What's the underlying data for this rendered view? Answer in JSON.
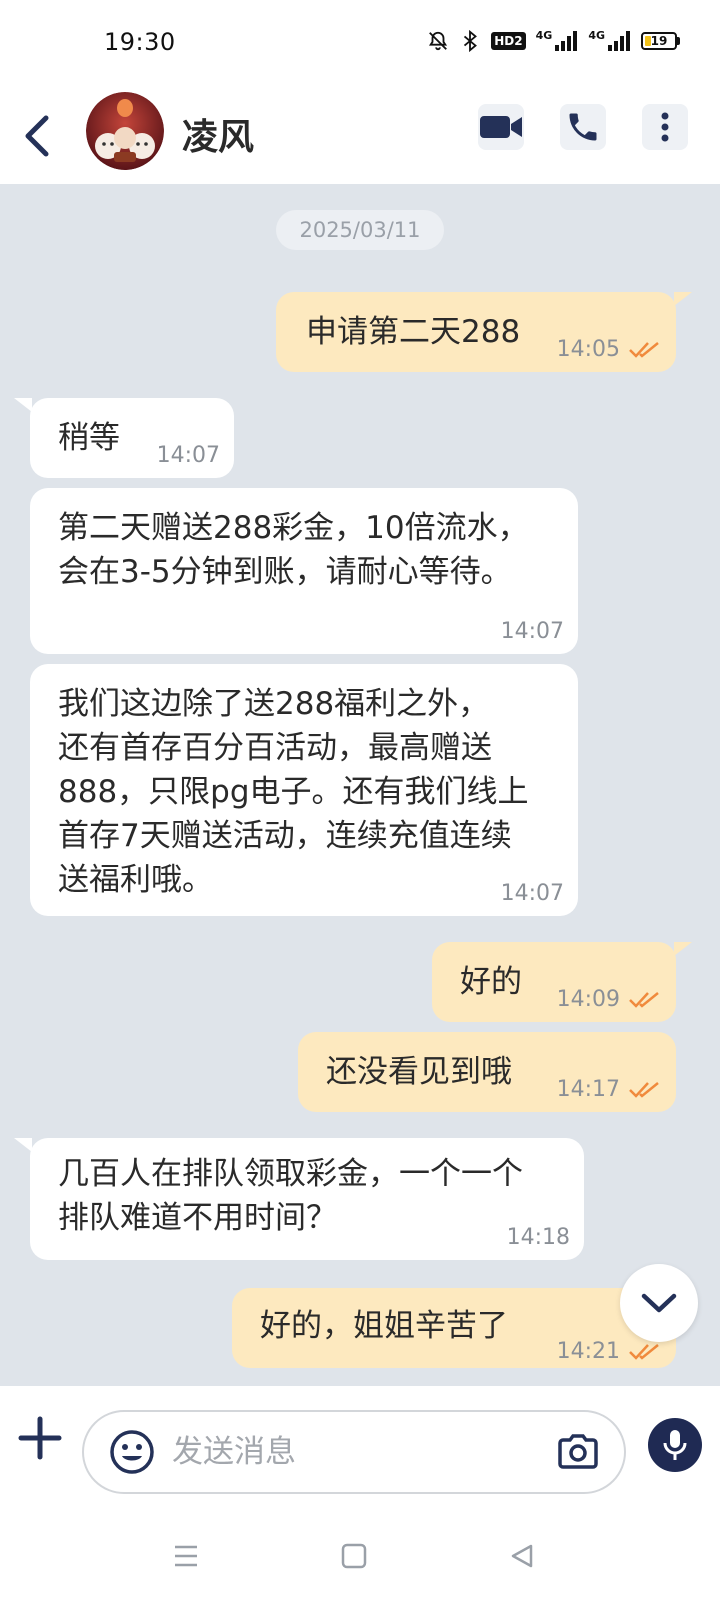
{
  "status_bar": {
    "time": "19:30",
    "hd_label": "HD2",
    "net1": "4G",
    "net2": "4G",
    "battery_level": "19"
  },
  "header": {
    "contact_name": "凌风",
    "icons": [
      "back-arrow-icon",
      "video-call-icon",
      "phone-icon",
      "more-icon"
    ]
  },
  "chat": {
    "date": "2025/03/11",
    "messages": [
      {
        "dir": "out",
        "lines": [
          "申请第二天288"
        ],
        "time": "14:05",
        "read": true
      },
      {
        "dir": "in",
        "lines": [
          "稍等"
        ],
        "time": "14:07"
      },
      {
        "dir": "in",
        "lines": [
          "第二天赠送288彩金，10倍流水，",
          "会在3-5分钟到账，请耐心等待。"
        ],
        "time": "14:07"
      },
      {
        "dir": "in",
        "lines": [
          "我们这边除了送288福利之外，",
          "还有首存百分百活动，最高赠送",
          "888，只限pg电子。还有我们线上",
          "首存7天赠送活动，连续充值连续",
          "送福利哦。"
        ],
        "time": "14:07"
      },
      {
        "dir": "out",
        "lines": [
          "好的"
        ],
        "time": "14:09",
        "read": true
      },
      {
        "dir": "out",
        "lines": [
          "还没看见到哦"
        ],
        "time": "14:17",
        "read": true
      },
      {
        "dir": "in",
        "lines": [
          "几百人在排队领取彩金，一个一个",
          "排队难道不用时间？"
        ],
        "time": "14:18"
      },
      {
        "dir": "out",
        "lines": [
          "好的，姐姐辛苦了"
        ],
        "time": "14:21",
        "read": true
      }
    ]
  },
  "input": {
    "placeholder": "发送消息"
  },
  "colors": {
    "chat_bg": "#dfe4ea",
    "bubble_out": "#fde9bf",
    "bubble_in": "#ffffff",
    "read_check": "#f08a3c",
    "accent": "#1f2a53"
  }
}
